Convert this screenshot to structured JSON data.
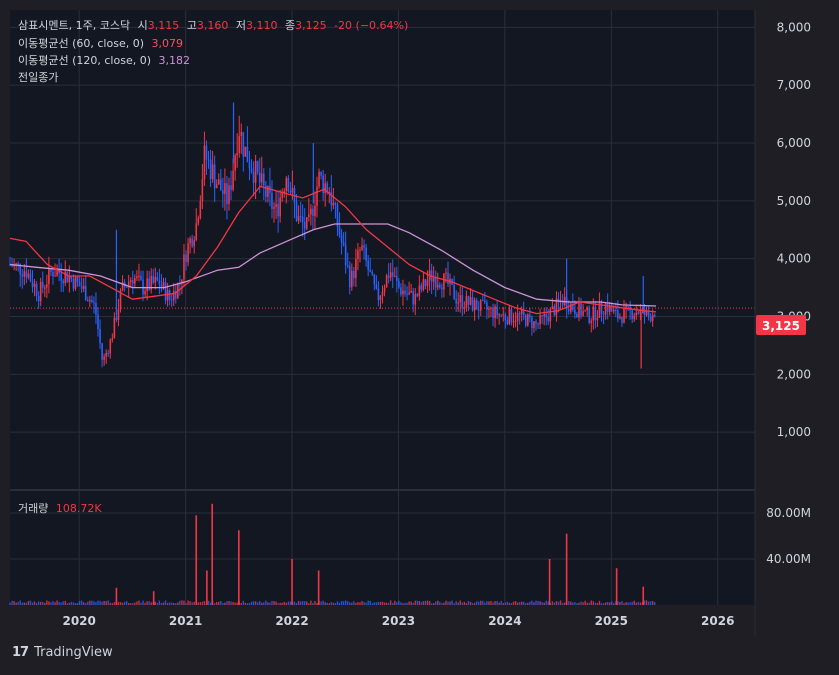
{
  "header": {
    "symbol": "삼표시멘트, 1주, 코스닥",
    "o_label": "시",
    "o": "3,115",
    "h_label": "고",
    "h": "3,160",
    "l_label": "저",
    "l": "3,110",
    "c_label": "종",
    "c": "3,125",
    "change": "-20 (−0.64%)",
    "ma60_label": "이동평균선 (60, close, 0)",
    "ma60_value": "3,079",
    "ma120_label": "이동평균선 (120, close, 0)",
    "ma120_value": "3,182",
    "prev_close_label": "전일종가",
    "volume_label": "거래량",
    "volume_value": "108.72K",
    "last_price_badge": "3,125"
  },
  "footer": {
    "brand": "TradingView",
    "logo": "17"
  },
  "colors": {
    "up": "#f23645",
    "down": "#2962ff",
    "ma60": "#f23645",
    "ma120": "#ce93d8",
    "background": "#1e1e24",
    "grid": "#2a2e39",
    "badge": "#f23645"
  },
  "chart_data": {
    "type": "candlestick",
    "price_axis": {
      "ticks": [
        "8,000",
        "7,000",
        "6,000",
        "5,000",
        "4,000",
        "3,000",
        "2,000",
        "1,000"
      ],
      "ylim": [
        0,
        8300
      ]
    },
    "volume_axis": {
      "ticks": [
        "80.00M",
        "40.00M"
      ]
    },
    "time_axis": {
      "ticks": [
        "2020",
        "2021",
        "2022",
        "2023",
        "2024",
        "2025",
        "2026"
      ],
      "xlim": [
        2019.35,
        2026.35
      ]
    },
    "price_path": [
      [
        2019.35,
        3900
      ],
      [
        2019.5,
        3800
      ],
      [
        2019.62,
        3400
      ],
      [
        2019.75,
        3800
      ],
      [
        2019.9,
        3700
      ],
      [
        2020.05,
        3450
      ],
      [
        2020.15,
        3150
      ],
      [
        2020.22,
        2200
      ],
      [
        2020.3,
        2600
      ],
      [
        2020.4,
        3450
      ],
      [
        2020.5,
        3700
      ],
      [
        2020.6,
        3500
      ],
      [
        2020.75,
        3600
      ],
      [
        2020.85,
        3300
      ],
      [
        2020.95,
        3600
      ],
      [
        2021.0,
        4100
      ],
      [
        2021.1,
        4600
      ],
      [
        2021.18,
        5800
      ],
      [
        2021.3,
        5300
      ],
      [
        2021.4,
        5000
      ],
      [
        2021.5,
        6300
      ],
      [
        2021.55,
        5900
      ],
      [
        2021.7,
        5300
      ],
      [
        2021.85,
        4800
      ],
      [
        2021.95,
        5500
      ],
      [
        2022.05,
        4700
      ],
      [
        2022.15,
        4500
      ],
      [
        2022.25,
        5400
      ],
      [
        2022.35,
        5200
      ],
      [
        2022.45,
        4400
      ],
      [
        2022.55,
        3600
      ],
      [
        2022.65,
        4200
      ],
      [
        2022.8,
        3300
      ],
      [
        2022.92,
        3800
      ],
      [
        2023.0,
        3500
      ],
      [
        2023.15,
        3300
      ],
      [
        2023.3,
        3700
      ],
      [
        2023.45,
        3600
      ],
      [
        2023.55,
        3300
      ],
      [
        2023.7,
        3200
      ],
      [
        2023.85,
        3100
      ],
      [
        2024.0,
        3000
      ],
      [
        2024.15,
        3000
      ],
      [
        2024.3,
        2850
      ],
      [
        2024.45,
        3100
      ],
      [
        2024.55,
        3300
      ],
      [
        2024.65,
        3150
      ],
      [
        2024.8,
        3000
      ],
      [
        2024.95,
        3200
      ],
      [
        2025.05,
        3000
      ],
      [
        2025.15,
        3050
      ],
      [
        2025.25,
        3100
      ],
      [
        2025.35,
        3000
      ],
      [
        2025.42,
        3125
      ]
    ],
    "spikes": [
      {
        "x": 2020.35,
        "high": 4500
      },
      {
        "x": 2021.45,
        "high": 6700
      },
      {
        "x": 2022.2,
        "high": 6000
      },
      {
        "x": 2024.58,
        "high": 4000
      },
      {
        "x": 2025.3,
        "high": 3700
      },
      {
        "x": 2025.28,
        "low": 2100
      }
    ],
    "ma60": [
      [
        2019.35,
        4350
      ],
      [
        2019.5,
        4300
      ],
      [
        2019.7,
        3900
      ],
      [
        2019.9,
        3700
      ],
      [
        2020.1,
        3700
      ],
      [
        2020.3,
        3500
      ],
      [
        2020.5,
        3300
      ],
      [
        2020.7,
        3350
      ],
      [
        2020.9,
        3400
      ],
      [
        2021.1,
        3700
      ],
      [
        2021.3,
        4200
      ],
      [
        2021.5,
        4800
      ],
      [
        2021.7,
        5250
      ],
      [
        2021.9,
        5150
      ],
      [
        2022.1,
        5050
      ],
      [
        2022.3,
        5200
      ],
      [
        2022.5,
        4900
      ],
      [
        2022.7,
        4500
      ],
      [
        2022.9,
        4200
      ],
      [
        2023.1,
        3900
      ],
      [
        2023.3,
        3700
      ],
      [
        2023.5,
        3600
      ],
      [
        2023.7,
        3450
      ],
      [
        2023.9,
        3300
      ],
      [
        2024.1,
        3150
      ],
      [
        2024.3,
        3050
      ],
      [
        2024.5,
        3100
      ],
      [
        2024.7,
        3250
      ],
      [
        2024.9,
        3200
      ],
      [
        2025.1,
        3150
      ],
      [
        2025.3,
        3100
      ],
      [
        2025.42,
        3079
      ]
    ],
    "ma120": [
      [
        2019.35,
        3900
      ],
      [
        2019.6,
        3850
      ],
      [
        2019.9,
        3800
      ],
      [
        2020.2,
        3700
      ],
      [
        2020.5,
        3500
      ],
      [
        2020.8,
        3500
      ],
      [
        2021.0,
        3600
      ],
      [
        2021.3,
        3800
      ],
      [
        2021.5,
        3850
      ],
      [
        2021.7,
        4100
      ],
      [
        2021.95,
        4300
      ],
      [
        2022.2,
        4500
      ],
      [
        2022.4,
        4600
      ],
      [
        2022.6,
        4600
      ],
      [
        2022.9,
        4600
      ],
      [
        2023.1,
        4450
      ],
      [
        2023.4,
        4150
      ],
      [
        2023.7,
        3800
      ],
      [
        2024.0,
        3500
      ],
      [
        2024.3,
        3300
      ],
      [
        2024.6,
        3250
      ],
      [
        2024.9,
        3250
      ],
      [
        2025.1,
        3200
      ],
      [
        2025.42,
        3182
      ]
    ],
    "prev_close": 3145,
    "volume_spikes": [
      {
        "x": 2020.35,
        "v": 15
      },
      {
        "x": 2020.7,
        "v": 12
      },
      {
        "x": 2021.1,
        "v": 78
      },
      {
        "x": 2021.2,
        "v": 30
      },
      {
        "x": 2021.25,
        "v": 88
      },
      {
        "x": 2021.5,
        "v": 65
      },
      {
        "x": 2022.0,
        "v": 40
      },
      {
        "x": 2022.25,
        "v": 30
      },
      {
        "x": 2024.42,
        "v": 40
      },
      {
        "x": 2024.58,
        "v": 62
      },
      {
        "x": 2025.05,
        "v": 32
      },
      {
        "x": 2025.3,
        "v": 16
      }
    ]
  }
}
